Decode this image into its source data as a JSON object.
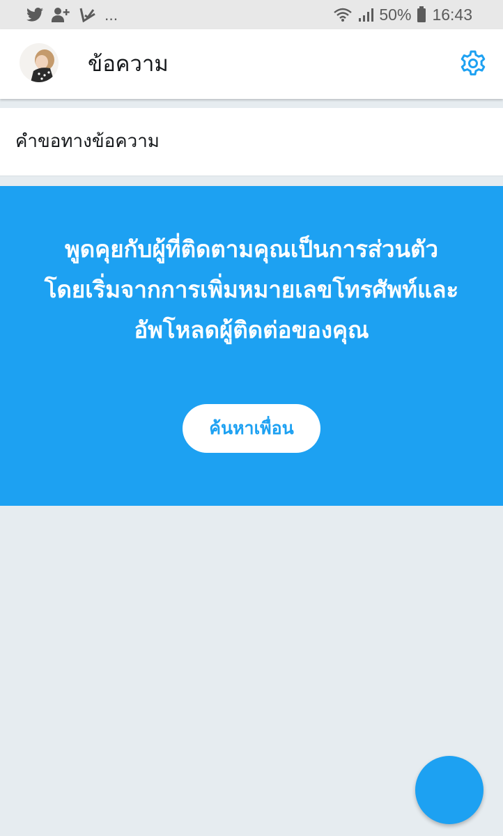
{
  "status_bar": {
    "overflow": "...",
    "battery": "50%",
    "time": "16:43",
    "icons": [
      "twitter-icon",
      "add-user-icon",
      "download-check-icon",
      "wifi-icon",
      "signal-icon",
      "battery-icon"
    ]
  },
  "header": {
    "title": "ข้อความ",
    "avatar": "user-avatar",
    "settings_icon": "gear-icon"
  },
  "requests": {
    "label": "คำขอทางข้อความ"
  },
  "promo": {
    "text": "พูดคุยกับผู้ที่ติดตามคุณเป็นการส่วนตัว โดยเริ่มจากการเพิ่มหมายเลขโทรศัพท์และอัพโหลดผู้ติดต่อของคุณ",
    "button_label": "ค้นหาเพื่อน"
  },
  "colors": {
    "accent": "#1da1f2",
    "background": "#e6ecf0",
    "status_bar": "#e8e8e8"
  }
}
